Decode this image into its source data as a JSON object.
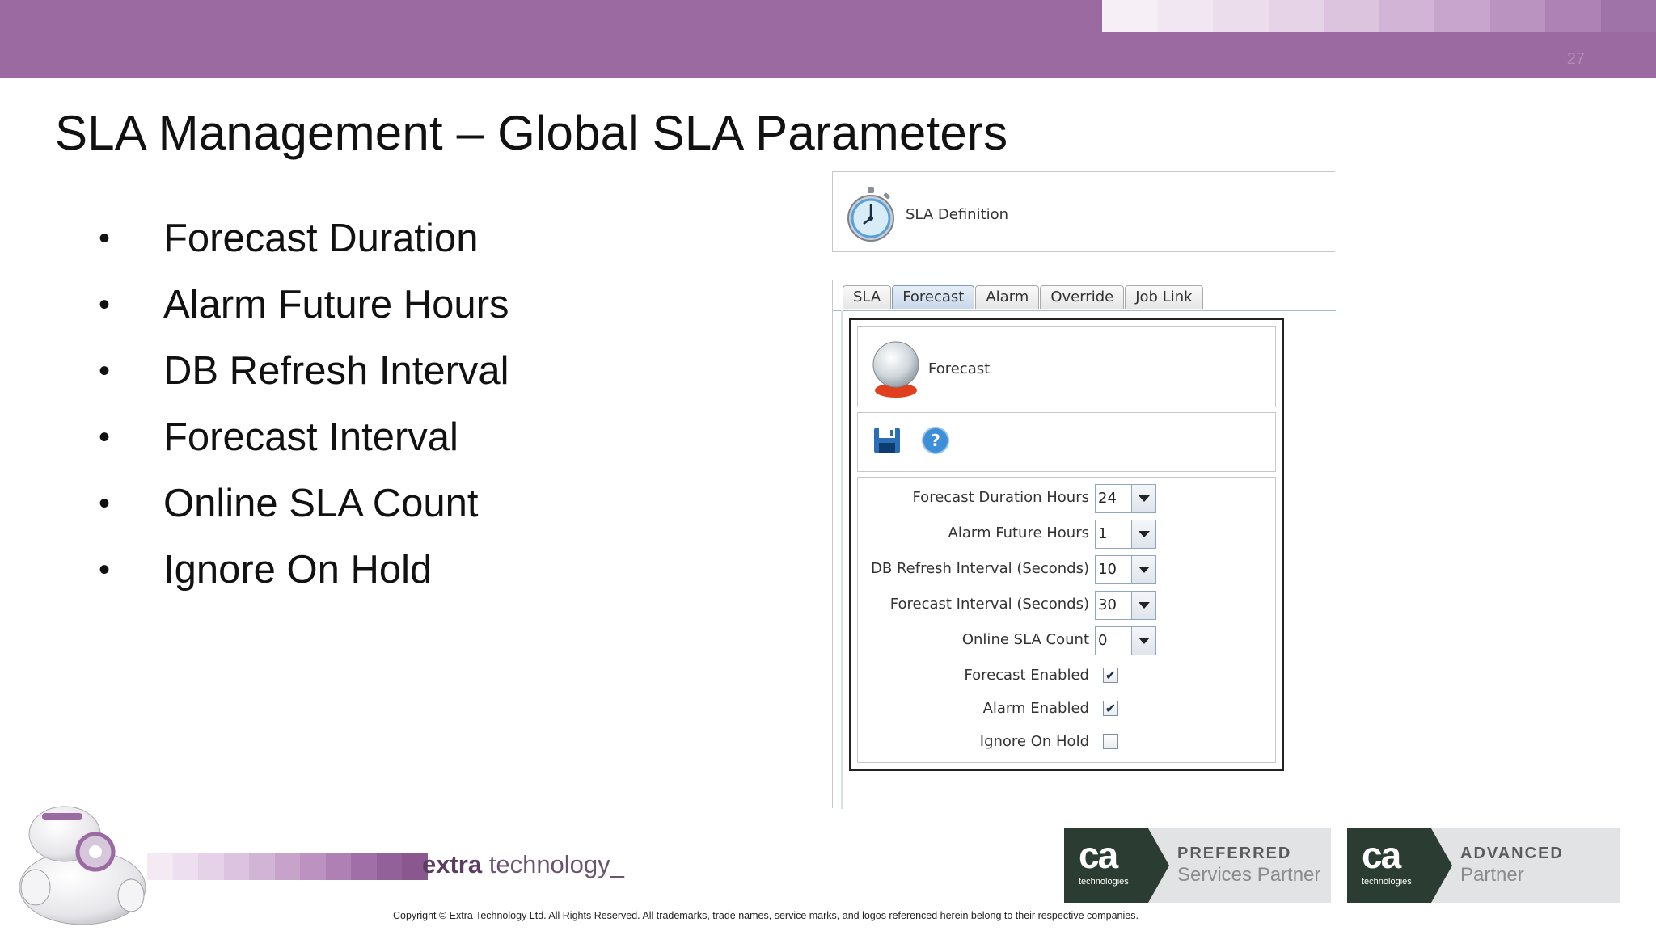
{
  "slide": {
    "number": "27",
    "title": "SLA Management – Global SLA Parameters",
    "bullets": [
      "Forecast Duration",
      "Alarm Future Hours",
      "DB Refresh Interval",
      "Forecast Interval",
      "Online SLA Count",
      "Ignore On Hold"
    ]
  },
  "sla_definition": {
    "title": "SLA Definition"
  },
  "tabs": [
    {
      "label": "SLA"
    },
    {
      "label": "Forecast"
    },
    {
      "label": "Alarm"
    },
    {
      "label": "Override"
    },
    {
      "label": "Job Link"
    }
  ],
  "active_tab": "Forecast",
  "forecast_panel": {
    "title": "Forecast",
    "fields": [
      {
        "label": "Forecast Duration Hours",
        "value": "24"
      },
      {
        "label": "Alarm Future Hours",
        "value": "1"
      },
      {
        "label": "DB Refresh Interval (Seconds)",
        "value": "10"
      },
      {
        "label": "Forecast Interval (Seconds)",
        "value": "30"
      },
      {
        "label": "Online SLA Count",
        "value": "0"
      }
    ],
    "checkboxes": [
      {
        "label": "Forecast Enabled",
        "checked": true
      },
      {
        "label": "Alarm Enabled",
        "checked": true
      },
      {
        "label": "Ignore On Hold",
        "checked": false
      }
    ]
  },
  "footer": {
    "brand_bold": "extra",
    "brand_rest": " technology_",
    "copyright": "Copyright © Extra Technology Ltd. All Rights Reserved. All trademarks, trade names, service marks, and logos referenced herein belong to their respective companies.",
    "badges": [
      {
        "logo": "ca",
        "logo_sub": "technologies",
        "line1": "PREFERRED",
        "line2": "Services Partner"
      },
      {
        "logo": "ca",
        "logo_sub": "technologies",
        "line1": "ADVANCED",
        "line2": "Partner"
      }
    ]
  },
  "colors": {
    "banner": "#9a6aa0",
    "tab_active": "#c9d8ea",
    "badge_dark": "#2b3d33"
  },
  "icons": [
    "stopwatch-icon",
    "crystal-ball-icon",
    "save-icon",
    "help-icon",
    "robot-mascot"
  ]
}
